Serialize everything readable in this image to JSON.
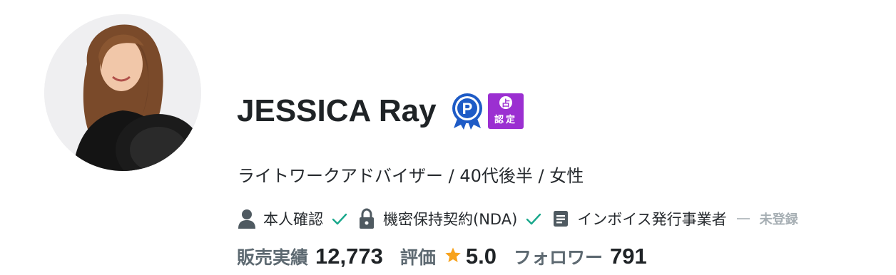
{
  "profile": {
    "name": "JESSICA Ray",
    "badges": {
      "p_badge_letter": "P",
      "certified_top": "占",
      "certified_bottom": "認定",
      "certified_color": "#9b2fd1",
      "p_badge_color": "#1e5bc6"
    },
    "subtitle": "ライトワークアドバイザー / 40代後半 / 女性",
    "avatar_icon": "avatar-photo"
  },
  "verifications": [
    {
      "icon": "person-icon",
      "label": "本人確認",
      "status": "verified"
    },
    {
      "icon": "lock-icon",
      "label": "機密保持契約(NDA)",
      "status": "verified"
    },
    {
      "icon": "document-icon",
      "label": "インボイス発行事業者",
      "status": "unregistered",
      "status_label": "未登録"
    }
  ],
  "stats": {
    "sales_label": "販売実績",
    "sales_value": "12,773",
    "rating_label": "評価",
    "rating_value": "5.0",
    "followers_label": "フォロワー",
    "followers_value": "791"
  },
  "colors": {
    "check": "#1aa88c",
    "star": "#f7a21b",
    "icon": "#4f5a61"
  }
}
